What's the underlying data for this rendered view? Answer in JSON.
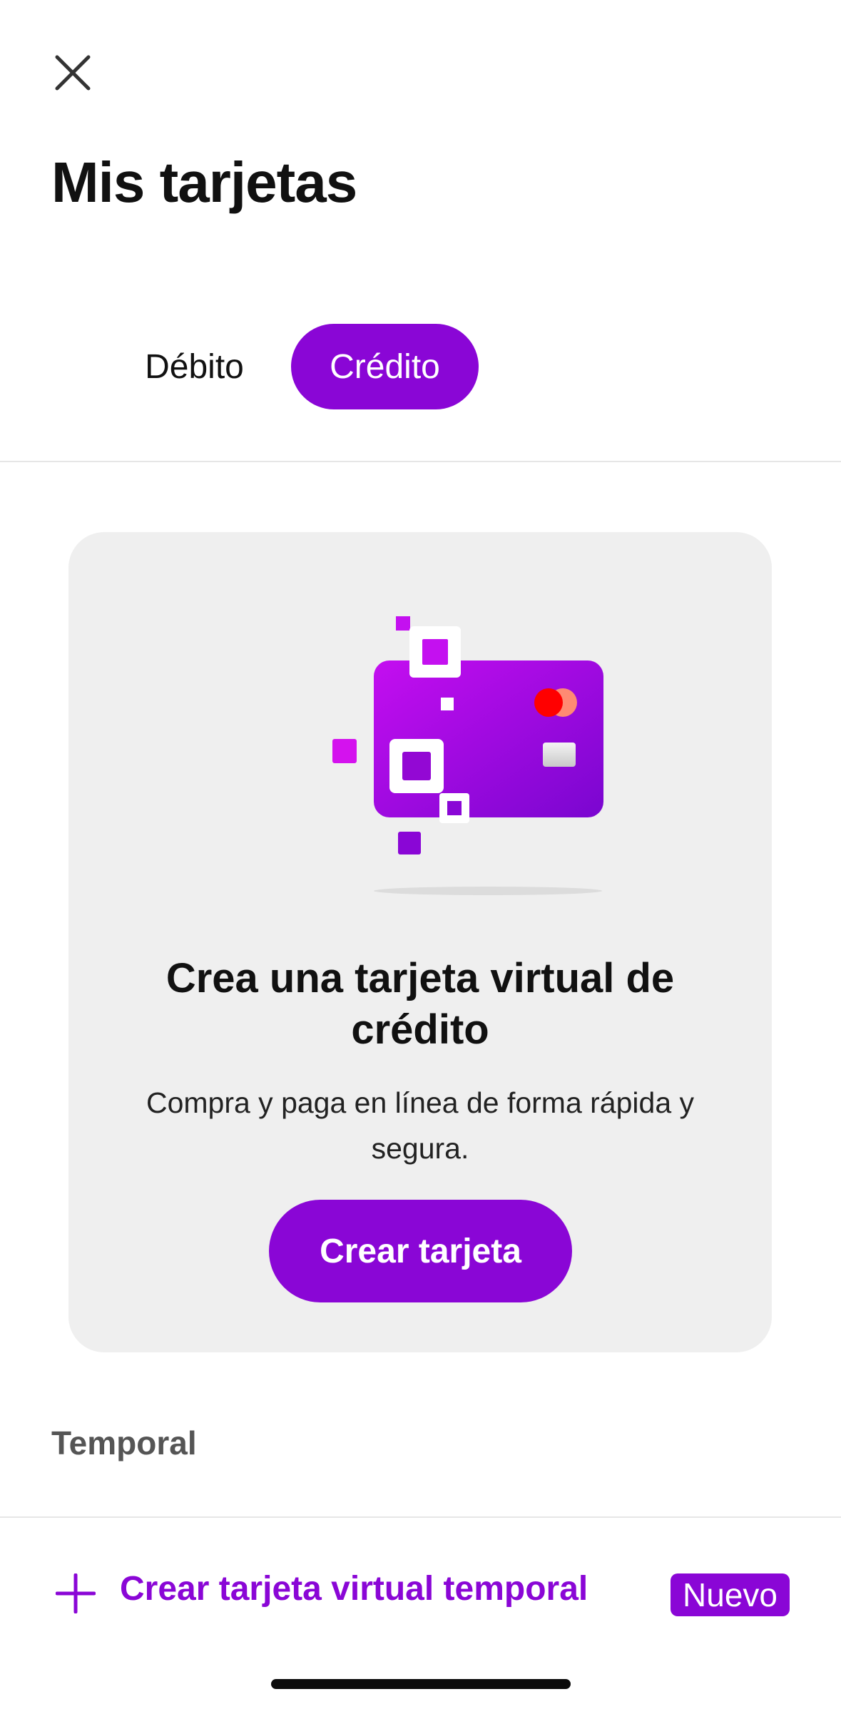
{
  "header": {
    "close_icon": "close-icon",
    "title": "Mis tarjetas"
  },
  "tabs": [
    {
      "label": "Débito",
      "active": false
    },
    {
      "label": "Crédito",
      "active": true
    }
  ],
  "promo_card": {
    "illustration": "virtual-credit-card-illustration",
    "title": "Crea una tarjeta virtual de crédito",
    "subtitle": "Compra y paga en línea de forma rápida y segura.",
    "button_label": "Crear tarjeta"
  },
  "temporal_section": {
    "label": "Temporal",
    "action_icon": "plus-icon",
    "action_label": "Crear tarjeta virtual temporal",
    "badge": "Nuevo"
  },
  "colors": {
    "accent": "#8a06d6",
    "card_background": "#efefef",
    "text": "#111111"
  }
}
